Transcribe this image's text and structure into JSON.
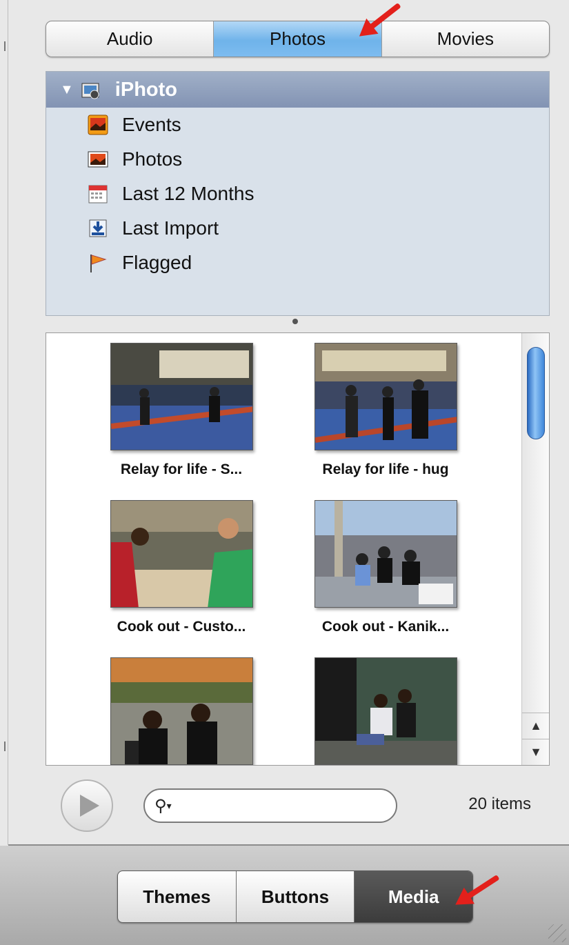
{
  "top_tabs": [
    "Audio",
    "Photos",
    "Movies"
  ],
  "top_tabs_selected": "Photos",
  "source_list": {
    "header": "iPhoto",
    "items": [
      "Events",
      "Photos",
      "Last 12 Months",
      "Last Import",
      "Flagged"
    ]
  },
  "photos": [
    {
      "caption": "Relay for life - S..."
    },
    {
      "caption": "Relay for life - hug"
    },
    {
      "caption": "Cook out - Custo..."
    },
    {
      "caption": "Cook out - Kanik..."
    },
    {
      "caption": ""
    },
    {
      "caption": ""
    }
  ],
  "search": {
    "value": ""
  },
  "item_count": "20 items",
  "bottom_tabs": [
    "Themes",
    "Buttons",
    "Media"
  ],
  "bottom_tabs_selected": "Media",
  "colors": {
    "selected_tab": "#6fb3ea",
    "source_header": "#8293b3",
    "annotation_arrow": "#e3201b"
  }
}
